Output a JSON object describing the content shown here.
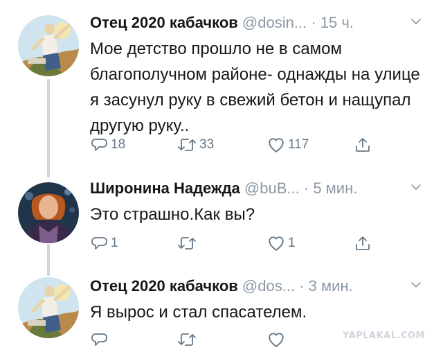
{
  "tweets": [
    {
      "author_name": "Отец 2020 кабачков",
      "handle": "@dosin...",
      "separator": "·",
      "time": "15 ч.",
      "avatar": "illustrated-avatar",
      "text": "Мое детство прошло не в самом благополучном районе- однажды на улице я засунул руку в свежий бетон и нащупал другую руку..",
      "replies": "18",
      "retweets": "33",
      "likes": "117"
    },
    {
      "author_name": "Широнина Надежда",
      "handle": "@buB...",
      "separator": "·",
      "time": "5 мин.",
      "avatar": "photo-avatar",
      "text": "Это страшно.Как вы?",
      "replies": "1",
      "retweets": "",
      "likes": "1"
    },
    {
      "author_name": "Отец 2020 кабачков",
      "handle": "@dos...",
      "separator": "·",
      "time": "3 мин.",
      "avatar": "illustrated-avatar",
      "text": "Я вырос и  стал спасателем.",
      "replies": "",
      "retweets": "",
      "likes": ""
    }
  ],
  "icons": {
    "reply": "reply-icon",
    "retweet": "retweet-icon",
    "like": "heart-icon",
    "share": "share-icon",
    "more": "chevron-down-icon"
  },
  "colors": {
    "text": "#14171a",
    "muted": "#8b98a5",
    "thread_line": "#ccd6dd"
  },
  "watermark": "YAPLAKAL.COM"
}
